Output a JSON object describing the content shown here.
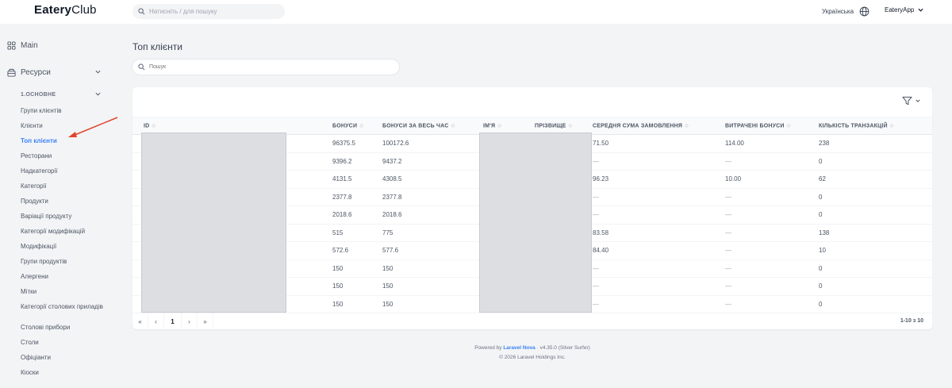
{
  "header": {
    "logo_bold": "Eatery",
    "logo_rest": "Club",
    "search_placeholder": "Натисніть / для пошуку",
    "language": "Українська",
    "user": "EateryApp"
  },
  "sidebar": {
    "main_label": "Main",
    "resources_label": "Ресурси",
    "group_label": "1.ОСНОВНЕ",
    "items": [
      "Групи клієнтів",
      "Клієнти",
      "Топ клієнти",
      "Ресторани",
      "Надкатегорії",
      "Категорії",
      "Продукти",
      "Варіації продукту",
      "Категорії модифікацій",
      "Модифікації",
      "Групи продуктів",
      "Алергени",
      "Мітки",
      "Категорії столових приладів",
      "Столові прибори",
      "Столи",
      "Офіціанти",
      "Кіоски"
    ],
    "active_index": 2
  },
  "main": {
    "title": "Топ клієнти",
    "search_placeholder": "Пошук"
  },
  "table": {
    "columns": [
      "ID",
      "Бонуси",
      "Бонуси за весь час",
      "Ім'я",
      "Прізвище",
      "Середня сума замовлення",
      "Витрачені бонуси",
      "Кількість транзакцій"
    ],
    "rows": [
      {
        "bonus": "96375.5",
        "total": "100172.6",
        "avg": "71.50",
        "spent": "114.00",
        "tx": "238"
      },
      {
        "bonus": "9396.2",
        "total": "9437.2",
        "avg": "—",
        "spent": "—",
        "tx": "0"
      },
      {
        "bonus": "4131.5",
        "total": "4308.5",
        "avg": "96.23",
        "spent": "10.00",
        "tx": "62"
      },
      {
        "bonus": "2377.8",
        "total": "2377.8",
        "avg": "—",
        "spent": "—",
        "tx": "0"
      },
      {
        "bonus": "2018.6",
        "total": "2018.6",
        "avg": "—",
        "spent": "—",
        "tx": "0"
      },
      {
        "bonus": "515",
        "total": "775",
        "avg": "83.58",
        "spent": "—",
        "tx": "138"
      },
      {
        "bonus": "572.6",
        "total": "577.6",
        "avg": "84.40",
        "spent": "—",
        "tx": "10"
      },
      {
        "bonus": "150",
        "total": "150",
        "avg": "—",
        "spent": "—",
        "tx": "0"
      },
      {
        "bonus": "150",
        "total": "150",
        "avg": "—",
        "spent": "—",
        "tx": "0"
      },
      {
        "bonus": "150",
        "total": "150",
        "avg": "—",
        "spent": "—",
        "tx": "0"
      }
    ]
  },
  "pagination": {
    "first": "«",
    "prev": "‹",
    "current": "1",
    "next": "›",
    "last": "»",
    "count": "1-10 з 10"
  },
  "footer": {
    "powered_prefix": "Powered by",
    "nova": "Laravel Nova",
    "version": "· v4.35.0 (Silver Surfer)",
    "copyright": "© 2026 Laravel Holdings Inc."
  },
  "colors": {
    "accent": "#3b82f6",
    "arrow": "#e0442b",
    "background": "#f3f4f6"
  },
  "icons": [
    "search-icon",
    "globe-icon",
    "chevron-down-icon",
    "grid-icon",
    "archive-icon",
    "filter-icon",
    "sort-icon"
  ]
}
